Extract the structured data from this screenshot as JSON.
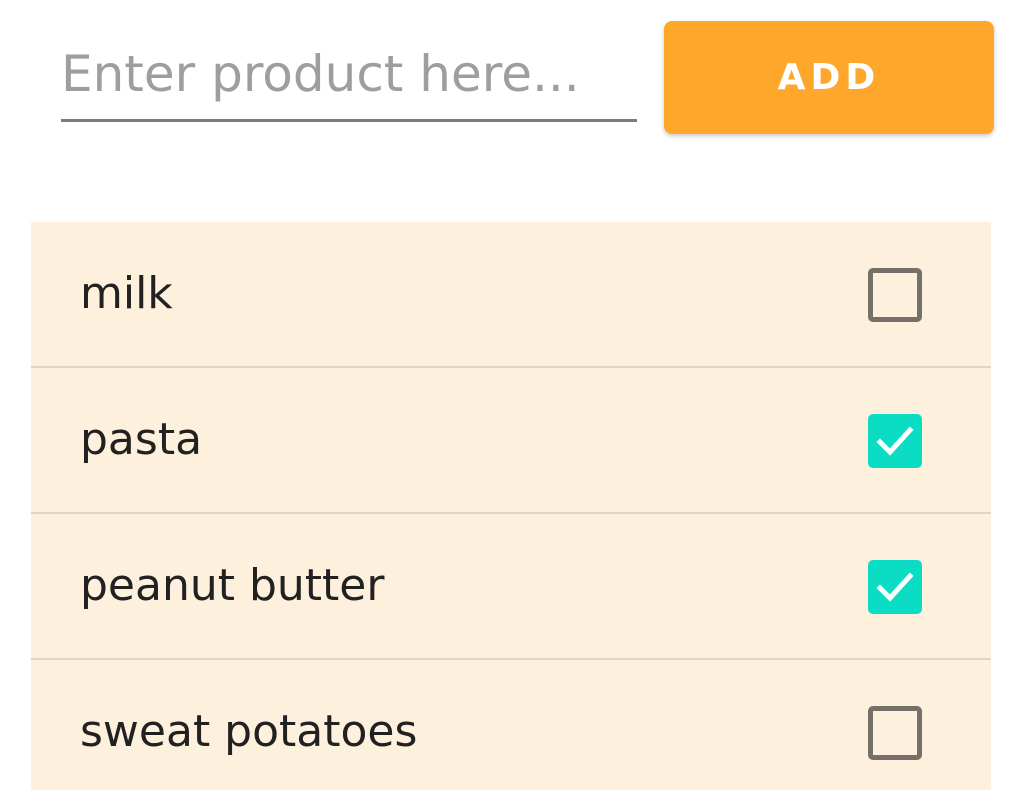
{
  "form": {
    "placeholder": "Enter product here...",
    "value": "",
    "add_label": "ADD"
  },
  "colors": {
    "accent": "#ffa72a",
    "check": "#0bdcc4",
    "list_bg": "#fdf0dc"
  },
  "items": [
    {
      "label": "milk",
      "checked": false
    },
    {
      "label": "pasta",
      "checked": true
    },
    {
      "label": "peanut butter",
      "checked": true
    },
    {
      "label": "sweat potatoes",
      "checked": false
    }
  ]
}
